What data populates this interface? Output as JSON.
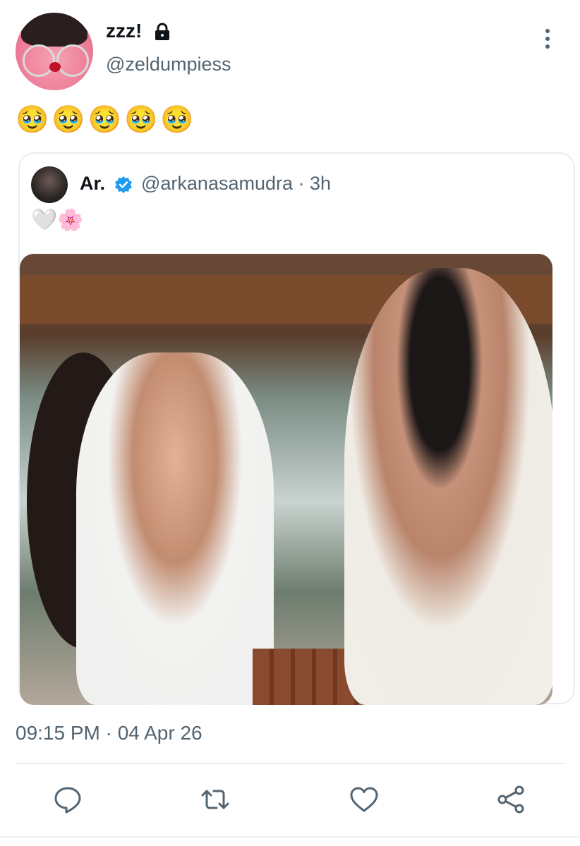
{
  "tweet": {
    "display_name": "zzz!",
    "handle": "@zeldumpiess",
    "text": "🥹🥹🥹🥹🥹",
    "timestamp": "09:15 PM · 04 Apr 26",
    "protected_icon": "lock-icon",
    "menu_icon": "more-vertical-icon"
  },
  "quoted_tweet": {
    "display_name": "Ar.",
    "handle_and_time": "@arkanasamudra · 3h",
    "verified_icon": "verified-badge-icon",
    "text": "🤍🌸"
  },
  "actions": {
    "reply_icon": "reply-icon",
    "retweet_icon": "retweet-icon",
    "like_icon": "heart-icon",
    "share_icon": "share-icon"
  },
  "colors": {
    "text": "#0f1419",
    "muted": "#536471",
    "border": "#e6ecf0",
    "verified": "#1d9bf0"
  }
}
